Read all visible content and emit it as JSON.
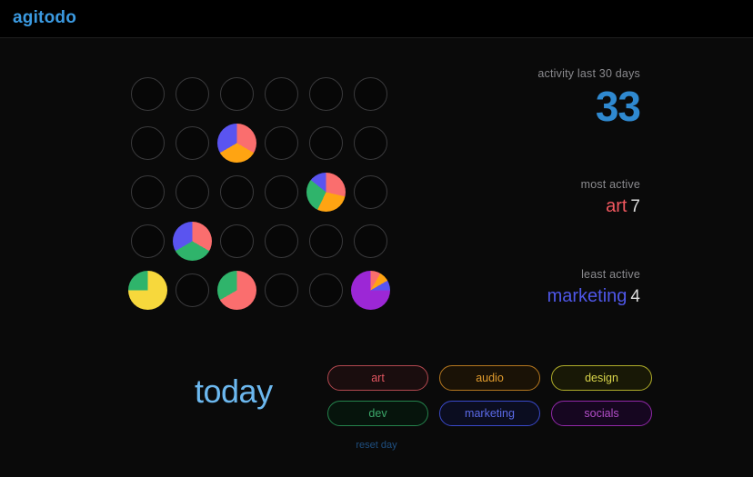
{
  "header": {
    "logo": "agitodo",
    "logo_color": "#3b9ae1"
  },
  "stats": {
    "activity": {
      "label": "activity last 30 days",
      "value": "33",
      "value_color": "#2f89d0"
    },
    "most_active": {
      "label": "most active",
      "name": "art",
      "name_color": "#f2585f",
      "count": "7"
    },
    "least_active": {
      "label": "least active",
      "name": "marketing",
      "name_color": "#4f57e8",
      "count": "4"
    }
  },
  "today": {
    "label": "today",
    "color": "#6cb8ef"
  },
  "tags": [
    {
      "label": "art",
      "border": "#b2484f",
      "text": "#e05560",
      "bg": "#1a0d0e"
    },
    {
      "label": "audio",
      "border": "#b5771f",
      "text": "#e09b2d",
      "bg": "#1a1206"
    },
    {
      "label": "design",
      "border": "#b0ad2a",
      "text": "#d8d44a",
      "bg": "#181806"
    },
    {
      "label": "dev",
      "border": "#24824c",
      "text": "#3ca86a",
      "bg": "#06140c"
    },
    {
      "label": "marketing",
      "border": "#3a49c9",
      "text": "#5b6ae8",
      "bg": "#0b0d20"
    },
    {
      "label": "socials",
      "border": "#9128a8",
      "text": "#b34ec9",
      "bg": "#160620"
    }
  ],
  "reset": {
    "label": "reset day",
    "color": "#1f4f80"
  },
  "palette": {
    "art": "#fa6e6e",
    "audio": "#ffa412",
    "design": "#f7d83c",
    "dev": "#2fb46b",
    "marketing": "#5a54f0",
    "socials": "#9c27d6",
    "empty_ring": "#3a3a3c",
    "empty_fill": "#070707"
  },
  "chart_data": {
    "type": "pie",
    "title": "activity last 30 days",
    "legend": [
      "art",
      "audio",
      "design",
      "dev",
      "marketing",
      "socials"
    ],
    "colors": {
      "art": "#fa6e6e",
      "audio": "#ffa412",
      "design": "#f7d83c",
      "dev": "#2fb46b",
      "marketing": "#5a54f0",
      "socials": "#9c27d6"
    },
    "grid": {
      "rows": 5,
      "cols": 6
    },
    "days": [
      {
        "row": 1,
        "col": 1,
        "total": 0,
        "slices": []
      },
      {
        "row": 1,
        "col": 2,
        "total": 0,
        "slices": []
      },
      {
        "row": 1,
        "col": 3,
        "total": 0,
        "slices": []
      },
      {
        "row": 1,
        "col": 4,
        "total": 0,
        "slices": []
      },
      {
        "row": 1,
        "col": 5,
        "total": 0,
        "slices": []
      },
      {
        "row": 1,
        "col": 6,
        "total": 0,
        "slices": []
      },
      {
        "row": 2,
        "col": 1,
        "total": 0,
        "slices": []
      },
      {
        "row": 2,
        "col": 2,
        "total": 0,
        "slices": []
      },
      {
        "row": 2,
        "col": 3,
        "total": 3,
        "slices": [
          {
            "tag": "art",
            "value": 1
          },
          {
            "tag": "audio",
            "value": 1
          },
          {
            "tag": "marketing",
            "value": 1
          }
        ]
      },
      {
        "row": 2,
        "col": 4,
        "total": 0,
        "slices": []
      },
      {
        "row": 2,
        "col": 5,
        "total": 0,
        "slices": []
      },
      {
        "row": 2,
        "col": 6,
        "total": 0,
        "slices": []
      },
      {
        "row": 3,
        "col": 1,
        "total": 0,
        "slices": []
      },
      {
        "row": 3,
        "col": 2,
        "total": 0,
        "slices": []
      },
      {
        "row": 3,
        "col": 3,
        "total": 0,
        "slices": []
      },
      {
        "row": 3,
        "col": 4,
        "total": 0,
        "slices": []
      },
      {
        "row": 3,
        "col": 5,
        "total": 7,
        "slices": [
          {
            "tag": "art",
            "value": 2
          },
          {
            "tag": "audio",
            "value": 2
          },
          {
            "tag": "dev",
            "value": 2
          },
          {
            "tag": "marketing",
            "value": 1
          }
        ]
      },
      {
        "row": 3,
        "col": 6,
        "total": 0,
        "slices": []
      },
      {
        "row": 4,
        "col": 1,
        "total": 0,
        "slices": []
      },
      {
        "row": 4,
        "col": 2,
        "total": 3,
        "slices": [
          {
            "tag": "art",
            "value": 1
          },
          {
            "tag": "dev",
            "value": 1
          },
          {
            "tag": "marketing",
            "value": 1
          }
        ]
      },
      {
        "row": 4,
        "col": 3,
        "total": 0,
        "slices": []
      },
      {
        "row": 4,
        "col": 4,
        "total": 0,
        "slices": []
      },
      {
        "row": 4,
        "col": 5,
        "total": 0,
        "slices": []
      },
      {
        "row": 4,
        "col": 6,
        "total": 0,
        "slices": []
      },
      {
        "row": 5,
        "col": 1,
        "total": 4,
        "slices": [
          {
            "tag": "design",
            "value": 3
          },
          {
            "tag": "dev",
            "value": 1
          }
        ]
      },
      {
        "row": 5,
        "col": 2,
        "total": 0,
        "slices": []
      },
      {
        "row": 5,
        "col": 3,
        "total": 3,
        "slices": [
          {
            "tag": "art",
            "value": 2
          },
          {
            "tag": "dev",
            "value": 1
          }
        ]
      },
      {
        "row": 5,
        "col": 4,
        "total": 0,
        "slices": []
      },
      {
        "row": 5,
        "col": 5,
        "total": 0,
        "slices": []
      },
      {
        "row": 5,
        "col": 6,
        "total": 12,
        "slices": [
          {
            "tag": "art",
            "value": 1
          },
          {
            "tag": "audio",
            "value": 1
          },
          {
            "tag": "marketing",
            "value": 1
          },
          {
            "tag": "socials",
            "value": 9
          }
        ]
      }
    ]
  }
}
